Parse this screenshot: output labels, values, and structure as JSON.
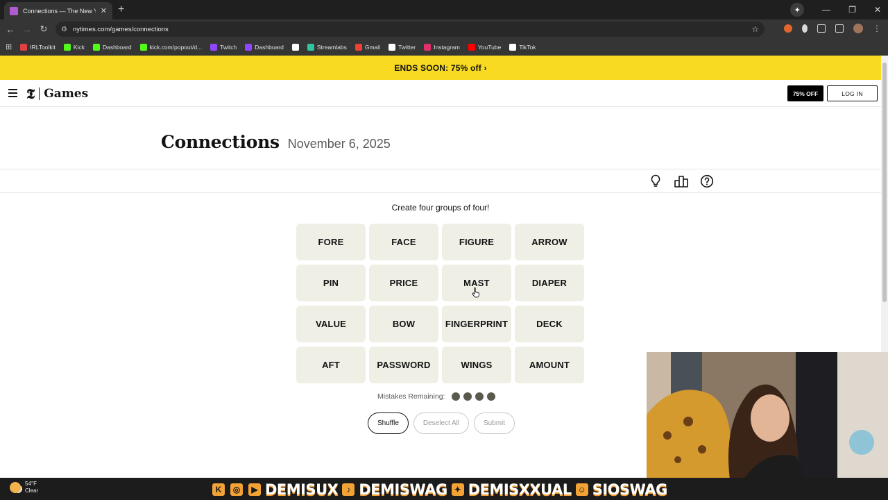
{
  "browser": {
    "tab_title": "Connections — The New York T",
    "url": "nytimes.com/games/connections",
    "bookmarks": [
      {
        "label": "IRLToolkit",
        "color": "#e04040"
      },
      {
        "label": "Kick",
        "color": "#53fc18"
      },
      {
        "label": "Dashboard",
        "color": "#53fc18"
      },
      {
        "label": "kick.com/popout/d...",
        "color": "#53fc18"
      },
      {
        "label": "Twitch",
        "color": "#9146ff"
      },
      {
        "label": "Dashboard",
        "color": "#9146ff"
      },
      {
        "label": "",
        "color": "#ffffff"
      },
      {
        "label": "Streamlabs",
        "color": "#31c3a2"
      },
      {
        "label": "Gmail",
        "color": "#ea4335"
      },
      {
        "label": "Twitter",
        "color": "#ffffff"
      },
      {
        "label": "Instagram",
        "color": "#e1306c"
      },
      {
        "label": "YouTube",
        "color": "#ff0000"
      },
      {
        "label": "TikTok",
        "color": "#ffffff"
      }
    ]
  },
  "promo": {
    "text": "ENDS SOON: 75% off ›"
  },
  "header": {
    "logo_t": "𝕿",
    "logo_games": "Games",
    "subscribe_label": "75% OFF",
    "login_label": "LOG IN"
  },
  "game": {
    "title": "Connections",
    "date": "November 6, 2025",
    "instructions": "Create four groups of four!",
    "tiles": [
      "FORE",
      "FACE",
      "FIGURE",
      "ARROW",
      "PIN",
      "PRICE",
      "MAST",
      "DIAPER",
      "VALUE",
      "BOW",
      "FINGERPRINT",
      "DECK",
      "AFT",
      "PASSWORD",
      "WINGS",
      "AMOUNT"
    ],
    "mistakes_label": "Mistakes Remaining:",
    "mistakes_remaining": 4,
    "buttons": {
      "shuffle": "Shuffle",
      "deselect": "Deselect All",
      "submit": "Submit"
    }
  },
  "taskbar": {
    "temp": "54°F",
    "condition": "Clear"
  },
  "stream_banner": [
    {
      "icon": "K",
      "text": ""
    },
    {
      "icon": "◎",
      "text": ""
    },
    {
      "icon": "▶",
      "text": "DEMISUX"
    },
    {
      "icon": "♪",
      "text": "DEMISWAG"
    },
    {
      "icon": "✦",
      "text": "DEMISXXUAL"
    },
    {
      "icon": "☺",
      "text": "SIOSWAG"
    }
  ]
}
